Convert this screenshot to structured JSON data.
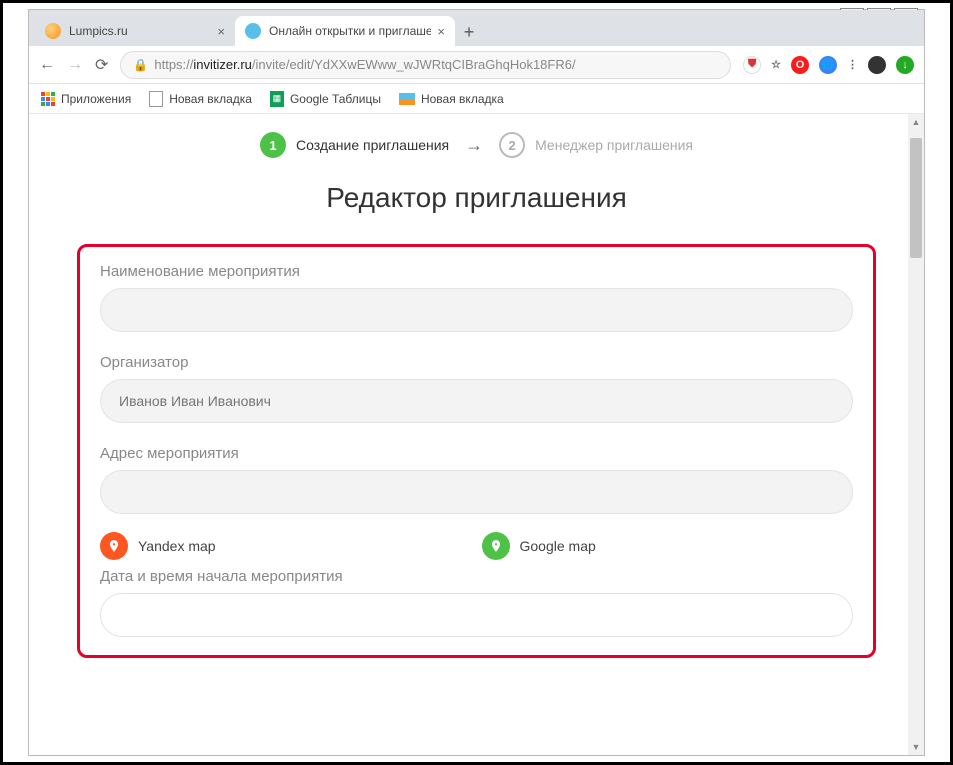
{
  "window": {
    "tabs": [
      {
        "title": "Lumpics.ru",
        "active": false
      },
      {
        "title": "Онлайн открытки и приглашен",
        "active": true
      }
    ]
  },
  "nav": {
    "url_scheme": "https://",
    "url_host": "invitizer.ru",
    "url_path": "/invite/edit/YdXXwEWww_wJWRtqCIBraGhqHok18FR6/"
  },
  "bookmarks": {
    "apps": "Приложения",
    "items": [
      "Новая вкладка",
      "Google Таблицы",
      "Новая вкладка"
    ]
  },
  "steps": {
    "one": {
      "num": "1",
      "label": "Создание приглашения"
    },
    "two": {
      "num": "2",
      "label": "Менеджер приглашения"
    }
  },
  "page": {
    "title": "Редактор приглашения"
  },
  "form": {
    "event_name_label": "Наименование мероприятия",
    "organizer_label": "Организатор",
    "organizer_placeholder": "Иванов Иван Иванович",
    "address_label": "Адрес мероприятия",
    "yandex_map": "Yandex map",
    "google_map": "Google map",
    "datetime_label": "Дата и время начала мероприятия"
  }
}
